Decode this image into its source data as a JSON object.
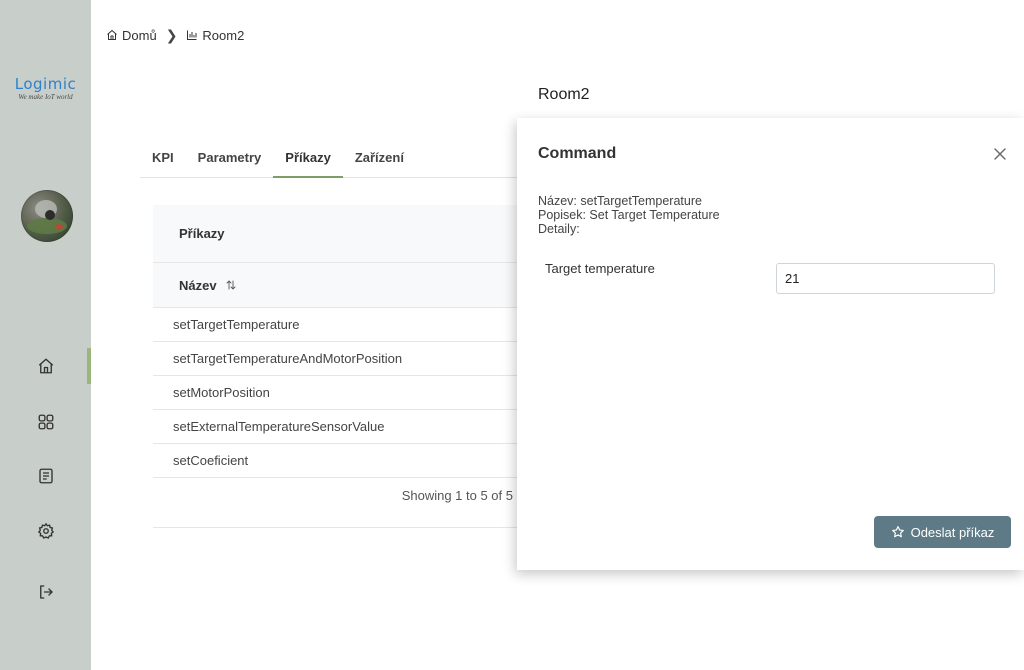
{
  "sidebar": {
    "logo_main": "Logimic",
    "logo_tagline": "We make IoT world",
    "nav_items": [
      {
        "icon": "home-icon"
      },
      {
        "icon": "grid-icon"
      },
      {
        "icon": "document-icon"
      },
      {
        "icon": "gear-icon"
      },
      {
        "icon": "logout-icon"
      }
    ]
  },
  "breadcrumb": {
    "home_label": "Domů",
    "separator": "❯",
    "current_label": "Room2"
  },
  "page": {
    "title": "Room2"
  },
  "tabs": [
    {
      "label": "KPI",
      "active": false
    },
    {
      "label": "Parametry",
      "active": false
    },
    {
      "label": "Příkazy",
      "active": true
    },
    {
      "label": "Zařízení",
      "active": false
    }
  ],
  "commands_table": {
    "header": "Příkazy",
    "column_name": "Název",
    "rows": [
      "setTargetTemperature",
      "setTargetTemperatureAndMotorPosition",
      "setMotorPosition",
      "setExternalTemperatureSensorValue",
      "setCoeficient"
    ],
    "footer": "Showing 1 to 5 of 5"
  },
  "command_panel": {
    "title": "Command",
    "info_name": "Název: setTargetTemperature",
    "info_description": "Popisek: Set Target Temperature",
    "info_details": "Detaily:",
    "field_label": "Target temperature",
    "field_value": "21",
    "submit_label": "Odeslat příkaz"
  },
  "colors": {
    "sidebar_bg": "#c8cec9",
    "accent_green": "#7d9c66",
    "button_bg": "#5d7a86",
    "logo_blue": "#2f80c8"
  }
}
